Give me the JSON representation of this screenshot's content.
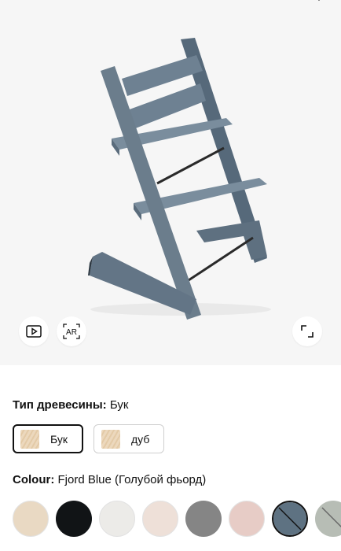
{
  "product": {
    "image_alt": "Tripp Trapp chair",
    "color_hex": "#6b7d8c"
  },
  "gallery": {
    "video_icon": "play-video-icon",
    "ar_label": "AR",
    "expand_icon": "expand-icon"
  },
  "wood": {
    "label": "Тип древесины:",
    "selected_value": "Бук",
    "options": [
      {
        "label": "Бук",
        "selected": true
      },
      {
        "label": "дуб",
        "selected": false
      }
    ]
  },
  "colour": {
    "label": "Colour:",
    "selected_value": "Fjord Blue (Голубой фьорд)",
    "swatches": [
      {
        "color": "#e9d9c3",
        "selected": false,
        "unavailable": false
      },
      {
        "color": "#111416",
        "selected": false,
        "unavailable": false
      },
      {
        "color": "#ecebe8",
        "selected": false,
        "unavailable": false
      },
      {
        "color": "#eee0d8",
        "selected": false,
        "unavailable": false
      },
      {
        "color": "#858585",
        "selected": false,
        "unavailable": false
      },
      {
        "color": "#e7ccc6",
        "selected": false,
        "unavailable": false
      },
      {
        "color": "#5e7282",
        "selected": true,
        "unavailable": true
      },
      {
        "color": "#b7bdb5",
        "selected": false,
        "unavailable": true
      }
    ]
  }
}
